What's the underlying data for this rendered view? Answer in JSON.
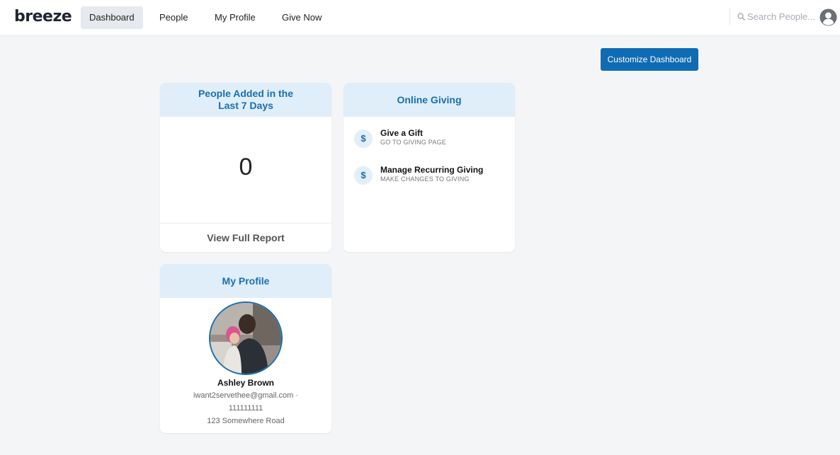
{
  "brand": {
    "logo": "breeze"
  },
  "nav": {
    "items": [
      {
        "label": "Dashboard",
        "active": true
      },
      {
        "label": "People",
        "active": false
      },
      {
        "label": "My Profile",
        "active": false
      },
      {
        "label": "Give Now",
        "active": false
      }
    ]
  },
  "search": {
    "placeholder": "Search People..."
  },
  "toolbar": {
    "customize_label": "Customize Dashboard"
  },
  "people_added": {
    "title_line1": "People Added in the",
    "title_line2": "Last 7 Days",
    "count": "0",
    "footer": "View Full Report"
  },
  "online_giving": {
    "title": "Online Giving",
    "items": [
      {
        "icon": "$",
        "title": "Give a Gift",
        "subtitle": "GO TO GIVING PAGE"
      },
      {
        "icon": "$",
        "title": "Manage Recurring Giving",
        "subtitle": "MAKE CHANGES TO GIVING"
      }
    ]
  },
  "my_profile": {
    "title": "My Profile",
    "name": "Ashley Brown",
    "contact_line1": "iwant2servethee@gmail.com ·",
    "contact_line2": "111111111",
    "address": "123 Somewhere Road"
  },
  "colors": {
    "accent": "#0f6bb3",
    "card_header_bg": "#dfeef9",
    "card_header_text": "#1a6fae",
    "page_bg": "#f4f5f7"
  }
}
